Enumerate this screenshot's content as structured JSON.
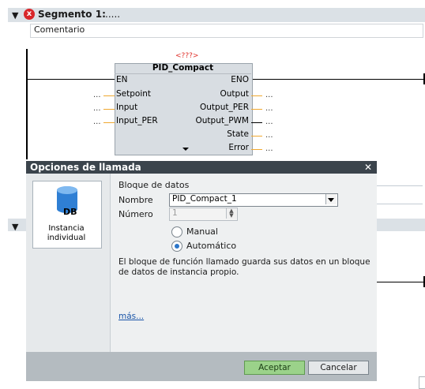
{
  "segment": {
    "toggle": "▼",
    "title": "Segmento 1:",
    "title_suffix": ".....",
    "comment": "Comentario",
    "error_icon": "x"
  },
  "segment2": {
    "toggle": "▼"
  },
  "block": {
    "instance_name": "<???>",
    "type": "PID_Compact",
    "inputs": [
      "EN",
      "Setpoint",
      "Input",
      "Input_PER"
    ],
    "outputs": [
      "ENO",
      "Output",
      "Output_PER",
      "Output_PWM",
      "State",
      "Error"
    ],
    "pin_placeholder": "..."
  },
  "dialog": {
    "title": "Opciones de llamada",
    "close_icon": "✕",
    "instance_card": {
      "icon": "DB",
      "label": "Instancia individual"
    },
    "section": "Bloque de datos",
    "name_label": "Nombre",
    "name_value": "PID_Compact_1",
    "number_label": "Número",
    "number_value": "1",
    "radio_manual": "Manual",
    "radio_auto": "Automático",
    "description": "El bloque de función llamado guarda sus datos en un bloque de datos de instancia propio.",
    "more_link": "más...",
    "ok": "Aceptar",
    "cancel": "Cancelar"
  },
  "colors": {
    "accent_ok": "#9bd28a",
    "error": "#d8262a",
    "dialog_dark": "#3b444c",
    "wire_output": "#f0a830"
  }
}
